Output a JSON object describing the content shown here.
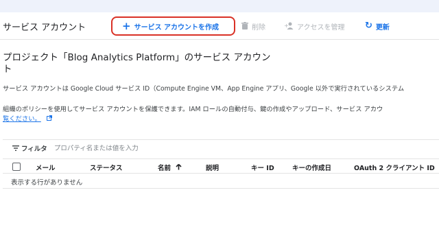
{
  "page_title": "サービス アカウント",
  "toolbar": {
    "create_label": "サービス アカウントを作成",
    "delete_label": "削除",
    "manage_access_label": "アクセスを管理",
    "refresh_label": "更新"
  },
  "heading": "プロジェクト「Blog Analytics Platform」のサービス アカウント",
  "description_1": "サービス アカウントは Google Cloud サービス ID（Compute Engine VM、App Engine アプリ、Google 以外で実行されているシステム",
  "description_2": "組織のポリシーを使用してサービス アカウントを保護できます。IAM ロールの自動付与、鍵の作成やアップロード、サービス アカウ",
  "learn_more_link": "覧ください。",
  "filter": {
    "label": "フィルタ",
    "placeholder": "プロパティ名または値を入力"
  },
  "table": {
    "columns": [
      "メール",
      "ステータス",
      "名前",
      "説明",
      "キー ID",
      "キーの作成日",
      "OAuth 2 クライアント ID"
    ],
    "sort_indicator": "arrow-up-icon",
    "empty_message": "表示する行がありません"
  },
  "colors": {
    "accent": "#1a73e8",
    "highlight_border": "#d93025",
    "disabled": "#b0b4b9"
  }
}
